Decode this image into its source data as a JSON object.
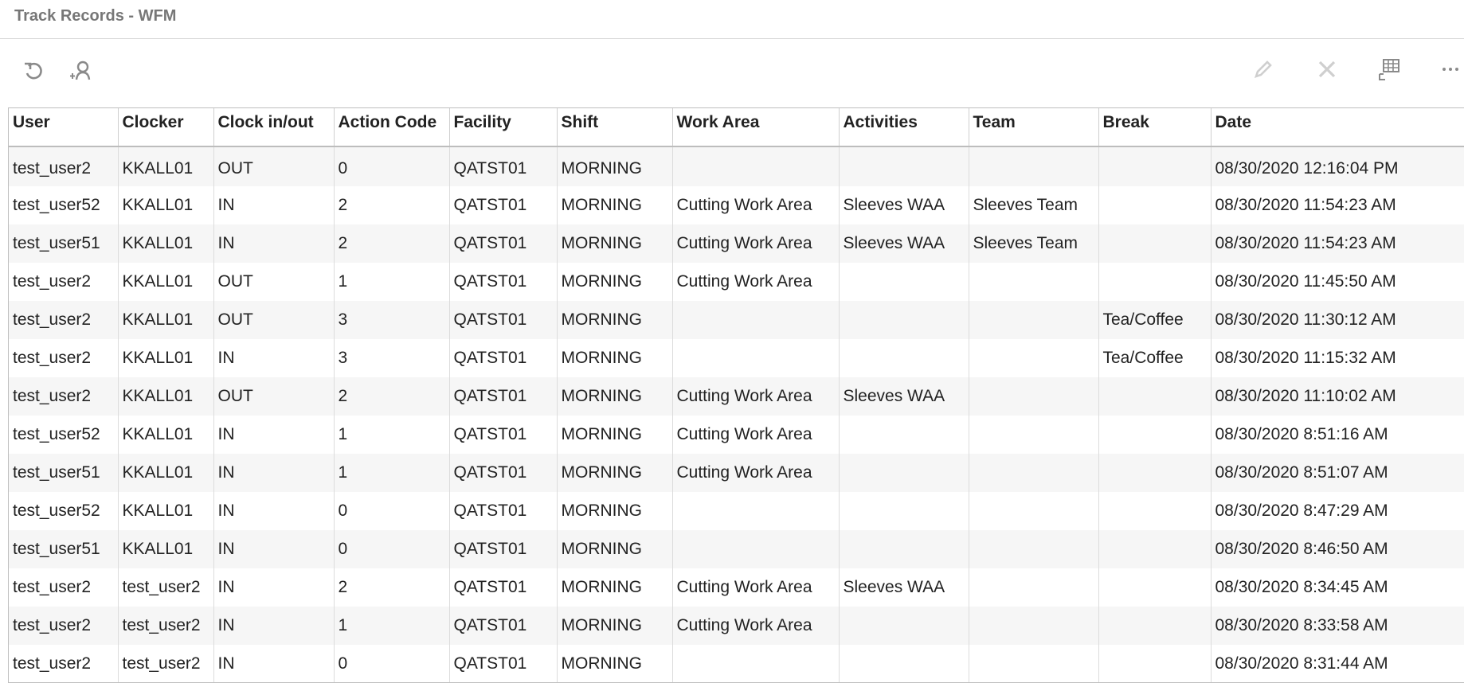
{
  "window": {
    "title": "Track Records - WFM"
  },
  "toolbar": {
    "left_icons": [
      "refresh-icon",
      "user-search-icon"
    ],
    "right_icons": [
      "pencil-icon",
      "close-icon",
      "table-settings-icon",
      "more-icon"
    ]
  },
  "grid": {
    "columns": [
      "User",
      "Clocker",
      "Clock in/out",
      "Action Code",
      "Facility",
      "Shift",
      "Work Area",
      "Activities",
      "Team",
      "Break",
      "Date"
    ],
    "rows": [
      [
        "test_user2",
        "KKALL01",
        "OUT",
        "0",
        "QATST01",
        "MORNING",
        "",
        "",
        "",
        "",
        "08/30/2020 12:16:04 PM"
      ],
      [
        "test_user52",
        "KKALL01",
        "IN",
        "2",
        "QATST01",
        "MORNING",
        "Cutting Work Area",
        "Sleeves WAA",
        "Sleeves Team",
        "",
        "08/30/2020 11:54:23 AM"
      ],
      [
        "test_user51",
        "KKALL01",
        "IN",
        "2",
        "QATST01",
        "MORNING",
        "Cutting Work Area",
        "Sleeves WAA",
        "Sleeves Team",
        "",
        "08/30/2020 11:54:23 AM"
      ],
      [
        "test_user2",
        "KKALL01",
        "OUT",
        "1",
        "QATST01",
        "MORNING",
        "Cutting Work Area",
        "",
        "",
        "",
        "08/30/2020 11:45:50 AM"
      ],
      [
        "test_user2",
        "KKALL01",
        "OUT",
        "3",
        "QATST01",
        "MORNING",
        "",
        "",
        "",
        "Tea/Coffee",
        "08/30/2020 11:30:12 AM"
      ],
      [
        "test_user2",
        "KKALL01",
        "IN",
        "3",
        "QATST01",
        "MORNING",
        "",
        "",
        "",
        "Tea/Coffee",
        "08/30/2020 11:15:32 AM"
      ],
      [
        "test_user2",
        "KKALL01",
        "OUT",
        "2",
        "QATST01",
        "MORNING",
        "Cutting Work Area",
        "Sleeves WAA",
        "",
        "",
        "08/30/2020 11:10:02 AM"
      ],
      [
        "test_user52",
        "KKALL01",
        "IN",
        "1",
        "QATST01",
        "MORNING",
        "Cutting Work Area",
        "",
        "",
        "",
        "08/30/2020 8:51:16 AM"
      ],
      [
        "test_user51",
        "KKALL01",
        "IN",
        "1",
        "QATST01",
        "MORNING",
        "Cutting Work Area",
        "",
        "",
        "",
        "08/30/2020 8:51:07 AM"
      ],
      [
        "test_user52",
        "KKALL01",
        "IN",
        "0",
        "QATST01",
        "MORNING",
        "",
        "",
        "",
        "",
        "08/30/2020 8:47:29 AM"
      ],
      [
        "test_user51",
        "KKALL01",
        "IN",
        "0",
        "QATST01",
        "MORNING",
        "",
        "",
        "",
        "",
        "08/30/2020 8:46:50 AM"
      ],
      [
        "test_user2",
        "test_user2",
        "IN",
        "2",
        "QATST01",
        "MORNING",
        "Cutting Work Area",
        "Sleeves WAA",
        "",
        "",
        "08/30/2020 8:34:45 AM"
      ],
      [
        "test_user2",
        "test_user2",
        "IN",
        "1",
        "QATST01",
        "MORNING",
        "Cutting Work Area",
        "",
        "",
        "",
        "08/30/2020 8:33:58 AM"
      ],
      [
        "test_user2",
        "test_user2",
        "IN",
        "0",
        "QATST01",
        "MORNING",
        "",
        "",
        "",
        "",
        "08/30/2020 8:31:44 AM"
      ]
    ]
  }
}
